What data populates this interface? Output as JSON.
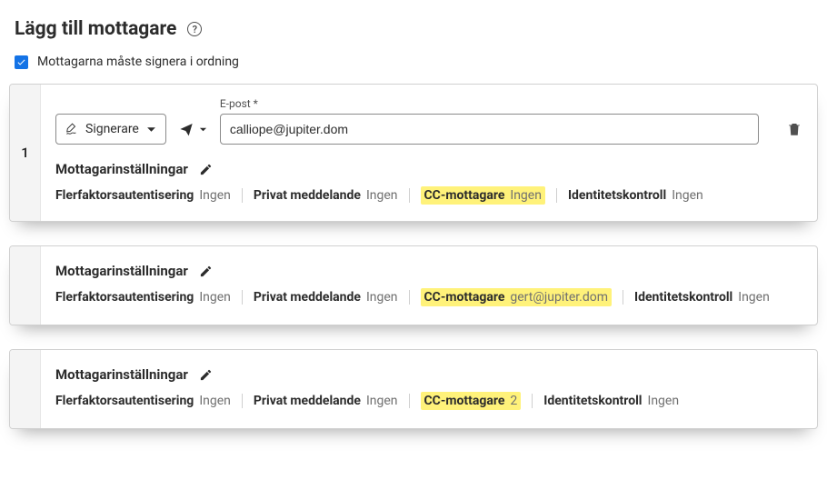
{
  "header": {
    "title": "Lägg till mottagare"
  },
  "ordering": {
    "label": "Mottagarna måste signera i ordning",
    "checked": true
  },
  "card1": {
    "order": "1",
    "role_label": "Signerare",
    "email_label": "E-post  *",
    "email_value": "calliope@jupiter.dom"
  },
  "settings_title": "Mottagarinställningar",
  "labels": {
    "mfa": "Flerfaktorsautentisering",
    "pm": "Privat meddelande",
    "cc": "CC-mottagare",
    "id": "Identitetskontroll"
  },
  "values": {
    "none": "Ingen",
    "gert": "gert@jupiter.dom",
    "two": "2"
  }
}
